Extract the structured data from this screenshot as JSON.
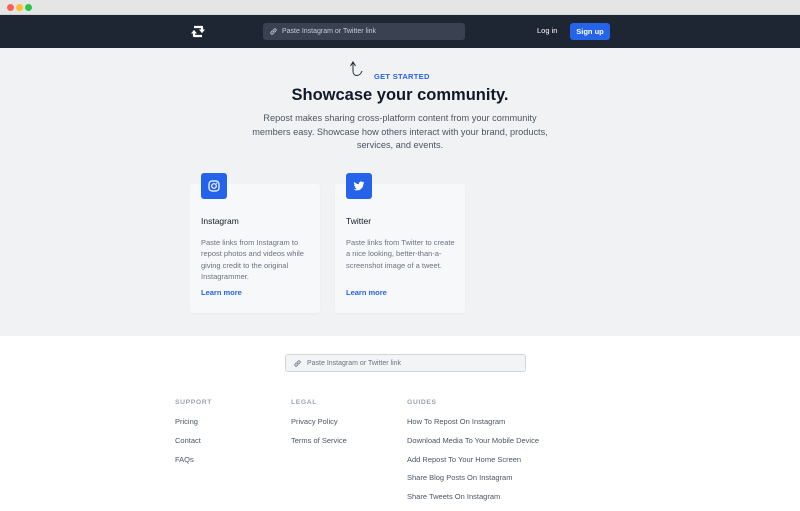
{
  "nav": {
    "search_placeholder": "Paste Instagram or Twitter link",
    "login": "Log in",
    "signup": "Sign up"
  },
  "hero": {
    "eyebrow": "GET STARTED",
    "title": "Showcase your community.",
    "description": "Repost makes sharing cross-platform content from your community members easy. Showcase how others interact with your brand, products, services, and events."
  },
  "cards": [
    {
      "icon": "instagram-icon",
      "title": "Instagram",
      "description": "Paste links from Instagram to repost photos and videos while giving credit to the original Instagrammer.",
      "link": "Learn more"
    },
    {
      "icon": "twitter-icon",
      "title": "Twitter",
      "description": "Paste links from Twitter to create a nice looking, better-than-a-screenshot image of a tweet.",
      "link": "Learn more"
    }
  ],
  "footer": {
    "search_placeholder": "Paste Instagram or Twitter link",
    "columns": [
      {
        "heading": "SUPPORT",
        "links": [
          "Pricing",
          "Contact",
          "FAQs"
        ]
      },
      {
        "heading": "LEGAL",
        "links": [
          "Privacy Policy",
          "Terms of Service"
        ]
      },
      {
        "heading": "GUIDES",
        "links": [
          "How To Repost On Instagram",
          "Download Media To Your Mobile Device",
          "Add Repost To Your Home Screen",
          "Share Blog Posts On Instagram",
          "Share Tweets On Instagram"
        ]
      }
    ]
  },
  "colors": {
    "accent": "#2563eb",
    "navbar": "#1e2533",
    "hero_bg": "#f1f2f4"
  }
}
